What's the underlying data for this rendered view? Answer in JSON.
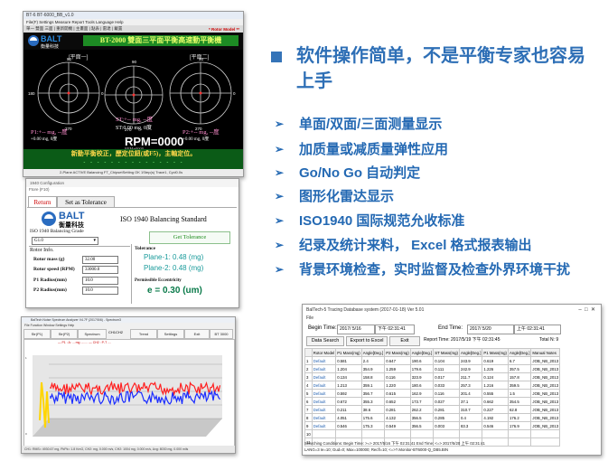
{
  "s1": {
    "title": "BT-6 BT-6000_BB_v1.0",
    "menu": "File(F)  Settings  Measure  Report  Tools  Language  Help",
    "toolbar": "單一 雙面 三面 | 重新開機 | 主畫面 | 點表 | 雷達  | 戴置 ",
    "rotor_model": "* Rotor Model **",
    "logo": "BALT",
    "logo_sub": "衡量科技",
    "banner": "BT-2000 雙面三平面平衡高速動平衡機",
    "plane_left": "[平面一]",
    "plane_right": "[平面二]",
    "p1": "P1:+-- mg, --度",
    "p1_sub": "+0.00 mg, 0度",
    "st": "ST:+-- mg, --度",
    "st_sub": "ST:0.00 mg, 0度",
    "p2": "P2:+-- mg, --度",
    "p2_sub": "+0.00 mg, 0度",
    "rpm": "RPM=0000",
    "rpm_sub": "RPM=0000",
    "scroll_text": "新動平衡校正，歷定位鈕(或F5)，主軸定位。",
    "dots": "- - - - - - - - - - - - - - -",
    "status": "2-Plane ACTIVE Balancing    FT_ChipsetSetting OK      1Step(s) Trace1, Cycl0.0s"
  },
  "s2": {
    "title": "1940 Configuration",
    "sub_title": "Ftore (F10)",
    "tab_return": "Return",
    "tab_tolerance": "Set as Tolerance",
    "logo": "BALT",
    "logo_sub": "衡量科技",
    "heading": "ISO 1940 Balancing Standard",
    "grade_label": "ISO 1940 Balancing Grade",
    "grade_value": "G1.0",
    "get_tolerance": "Get Tolerance",
    "rotor_info": "Rotor Info.",
    "rotor_mass_label": "Rotor mass (g)",
    "rotor_mass_value": "32.00",
    "rotor_speed_label": "Rotor speed (RPM)",
    "rotor_speed_value": "33000.0",
    "p1_radius_label": "P1 Radius(mm)",
    "p1_radius_value": "10.0",
    "p2_radius_label": "P2 Radius(mm)",
    "p2_radius_value": "10.0",
    "tolerance_label": "Tolerance",
    "plane1": "Plane-1: 0.48 (mg)",
    "plane2": "Plane-2: 0.48 (mg)",
    "ecc_label": "Permissible Eccentricity",
    "ecc_value": "e = 0.30 (um)"
  },
  "s3": {
    "title": "BalTech Noise Spectrum Analyzer V4.7F (2017/5/6) - Spectrum3",
    "menu": "File   Function   Window   Settings   Help",
    "tabs": [
      "Str(P1)",
      "Str(P2)",
      "Spectrum",
      "Trend",
      "Settings",
      "Exit",
      "BT 3000"
    ],
    "ch1": "CH1",
    "ch2": "CH2",
    "legend": "— P1 : A: ... mg   ........   — CH2 : P-T ....",
    "status": "CH1:  RMS= 4930.67 mg,  PkPk= 1.8 KmG,  CH2: mg, 0.000 m/s,  CH2: 1004 mg,  0.000 m/s,  Avg: 8030 mg, 0.000 mils"
  },
  "bullets": {
    "main": "软件操作简单，不是平衡专家也容易上手",
    "items": [
      "单面/双面/三面测量显示",
      "加质量或减质量弹性应用",
      "Go/No Go 自动判定",
      "图形化雷达显示",
      "ISO1940 国际规范允收标准",
      "纪录及统计来料， Excel 格式报表输出",
      "背景环境检查，实时监督及检查外界环境干扰"
    ]
  },
  "s4": {
    "title": "BalTech-5 Tracing Database system  (2017-01-18) Ver 5.01",
    "menu": "File",
    "begin_label": "Begin Time:",
    "begin_date": "2017/ 5/16",
    "begin_time": "下午 02:31:41",
    "end_label": "End Time:",
    "end_date": "2017/ 5/20",
    "end_time": "上午 02:31:41",
    "btn_search": "Data Search",
    "btn_excel": "Export to Excel",
    "btn_exit": "Exit",
    "report_time": "Report Time: 2017/5/19 下午 02:31:45",
    "total": "Total N: 9",
    "columns": [
      "",
      "Rotor Model",
      "P1 Mass(mg)",
      "Angle[Deg.]",
      "P2 Mass(mg)",
      "Angle[Deg.]",
      "ST Mass(mg)",
      "Angle[Deg.]",
      "P1 Mass(mg)",
      "Angle[Deg.]",
      "Manual Notes"
    ],
    "rows": [
      [
        "1",
        "Default",
        "0.581",
        "2.4",
        "0.647",
        "190.6",
        "0.104",
        "243.9",
        "0.619",
        "6.7",
        "JOB_NB_2013"
      ],
      [
        "2",
        "Default",
        "1.204",
        "354.9",
        "1.259",
        "179.6",
        "0.111",
        "242.9",
        "1.226",
        "357.5",
        "JOB_NB_2013"
      ],
      [
        "3",
        "Default",
        "0.134",
        "158.8",
        "0.116",
        "323.9",
        "0.017",
        "211.7",
        "0.124",
        "157.8",
        "JOB_NB_2013"
      ],
      [
        "4",
        "Default",
        "1.213",
        "359.1",
        "1.220",
        "180.6",
        "0.033",
        "257.3",
        "1.216",
        "359.5",
        "JOB_NB_2013"
      ],
      [
        "5",
        "Default",
        "0.592",
        "356.7",
        "0.615",
        "162.9",
        "0.116",
        "201.4",
        "0.555",
        "1.5",
        "JOB_NB_2013"
      ],
      [
        "6",
        "Default",
        "0.672",
        "355.3",
        "0.652",
        "173.7",
        "0.027",
        "37.1",
        "0.662",
        "354.5",
        "JOB_NB_2013"
      ],
      [
        "7",
        "Default",
        "0.211",
        "38.6",
        "0.281",
        "262.2",
        "0.281",
        "310.7",
        "0.227",
        "62.8",
        "JOB_NB_2013"
      ],
      [
        "8",
        "Default",
        "4.051",
        "175.6",
        "4.132",
        "356.5",
        "0.285",
        "0.4",
        "4.192",
        "176.2",
        "JOB_NB_2013"
      ],
      [
        "9",
        "Default",
        "0.546",
        "175.3",
        "0.549",
        "356.5",
        "0.003",
        "83.3",
        "0.546",
        "176.9",
        "JOB_NB_2013"
      ],
      [
        "10",
        "",
        "",
        "",
        "",
        "",
        "",
        "",
        "",
        "",
        ""
      ],
      [
        "11",
        "",
        "",
        "",
        "",
        "",
        "",
        "",
        "",
        "",
        ""
      ]
    ],
    "foot1": "Searching Conditions:  Begin Time: >=> 2017/5/16 下午 02:31:41        End Time: <=> 2017/5/20 上午 02:31:41",
    "foot2": "LANG=3                         Ie=10; Gud=0; Max=100000; Recfl=10; <=>?.Monitor-BT6000-Q_DB5.BIN"
  }
}
